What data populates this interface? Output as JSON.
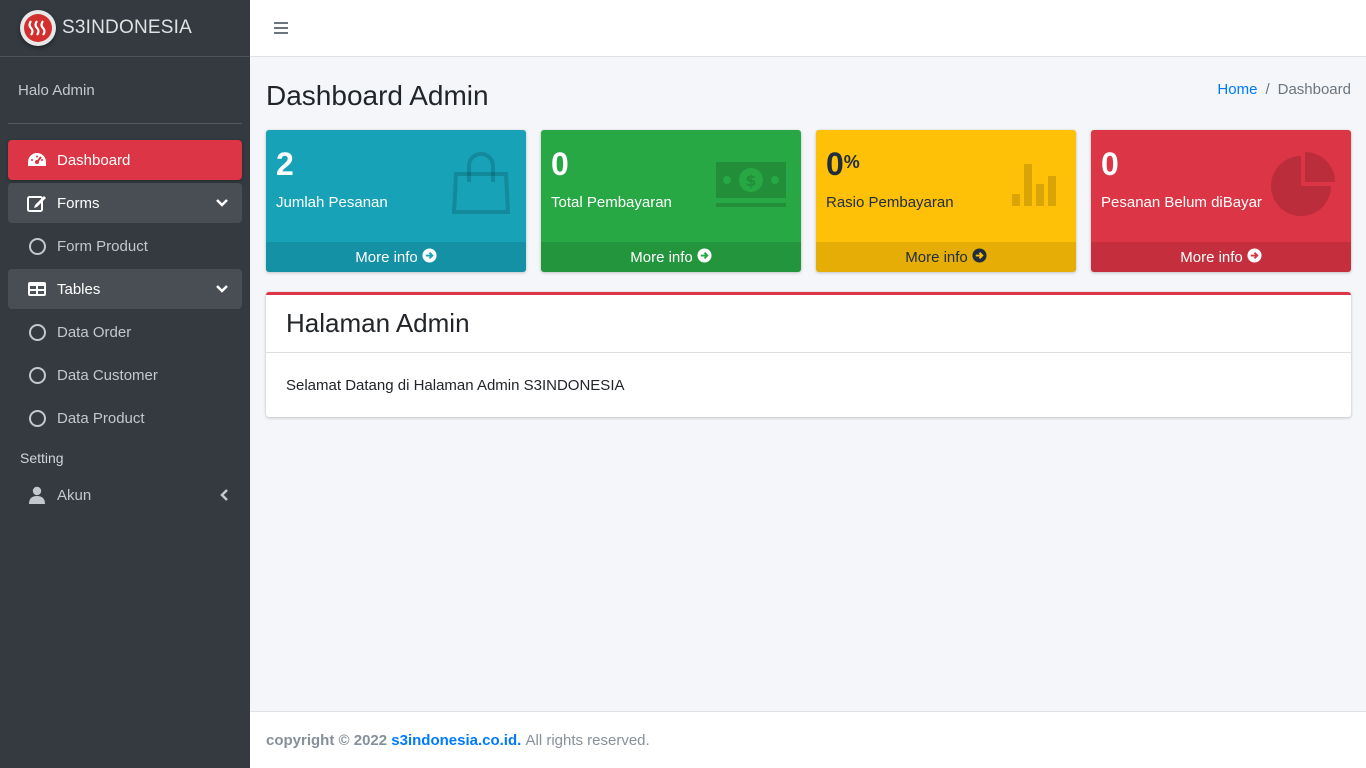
{
  "brand": {
    "name": "S3INDONESIA",
    "logo_icon": "s3-logo"
  },
  "user_panel": {
    "greeting": "Halo Admin"
  },
  "sidebar": {
    "items": [
      {
        "label": "Dashboard",
        "icon": "tachometer-icon",
        "state": "active"
      },
      {
        "label": "Forms",
        "icon": "edit-icon",
        "state": "open"
      },
      {
        "label": "Form Product",
        "icon": "circle-icon",
        "state": "sub"
      },
      {
        "label": "Tables",
        "icon": "table-icon",
        "state": "open"
      },
      {
        "label": "Data Order",
        "icon": "circle-icon",
        "state": "sub"
      },
      {
        "label": "Data Customer",
        "icon": "circle-icon",
        "state": "sub"
      },
      {
        "label": "Data Product",
        "icon": "circle-icon",
        "state": "sub"
      }
    ],
    "header_setting": "Setting",
    "akun": {
      "label": "Akun",
      "icon": "user-icon"
    }
  },
  "header": {
    "title": "Dashboard Admin",
    "breadcrumb": {
      "home": "Home",
      "separator": "/",
      "current": "Dashboard"
    }
  },
  "boxes": [
    {
      "value": "2",
      "sup": "",
      "label": "Jumlah Pesanan",
      "more": "More info",
      "icon": "shopping-bag-icon",
      "color": "#17a2b8"
    },
    {
      "value": "0",
      "sup": "",
      "label": "Total Pembayaran",
      "more": "More info",
      "icon": "money-bill-icon",
      "color": "#28a745"
    },
    {
      "value": "0",
      "sup": "%",
      "label": "Rasio Pembayaran",
      "more": "More info",
      "icon": "bar-chart-icon",
      "color": "#ffc107"
    },
    {
      "value": "0",
      "sup": "",
      "label": "Pesanan Belum diBayar",
      "more": "More info",
      "icon": "pie-chart-icon",
      "color": "#dc3545"
    }
  ],
  "card": {
    "title": "Halaman Admin",
    "body": "Selamat Datang di Halaman Admin S3INDONESIA"
  },
  "footer": {
    "copyright": "copyright © 2022",
    "link": "s3indonesia.co.id.",
    "rights": "All rights reserved."
  },
  "colors": {
    "sidebar": "#343a40",
    "active": "#dc3545",
    "link": "#007bff"
  }
}
